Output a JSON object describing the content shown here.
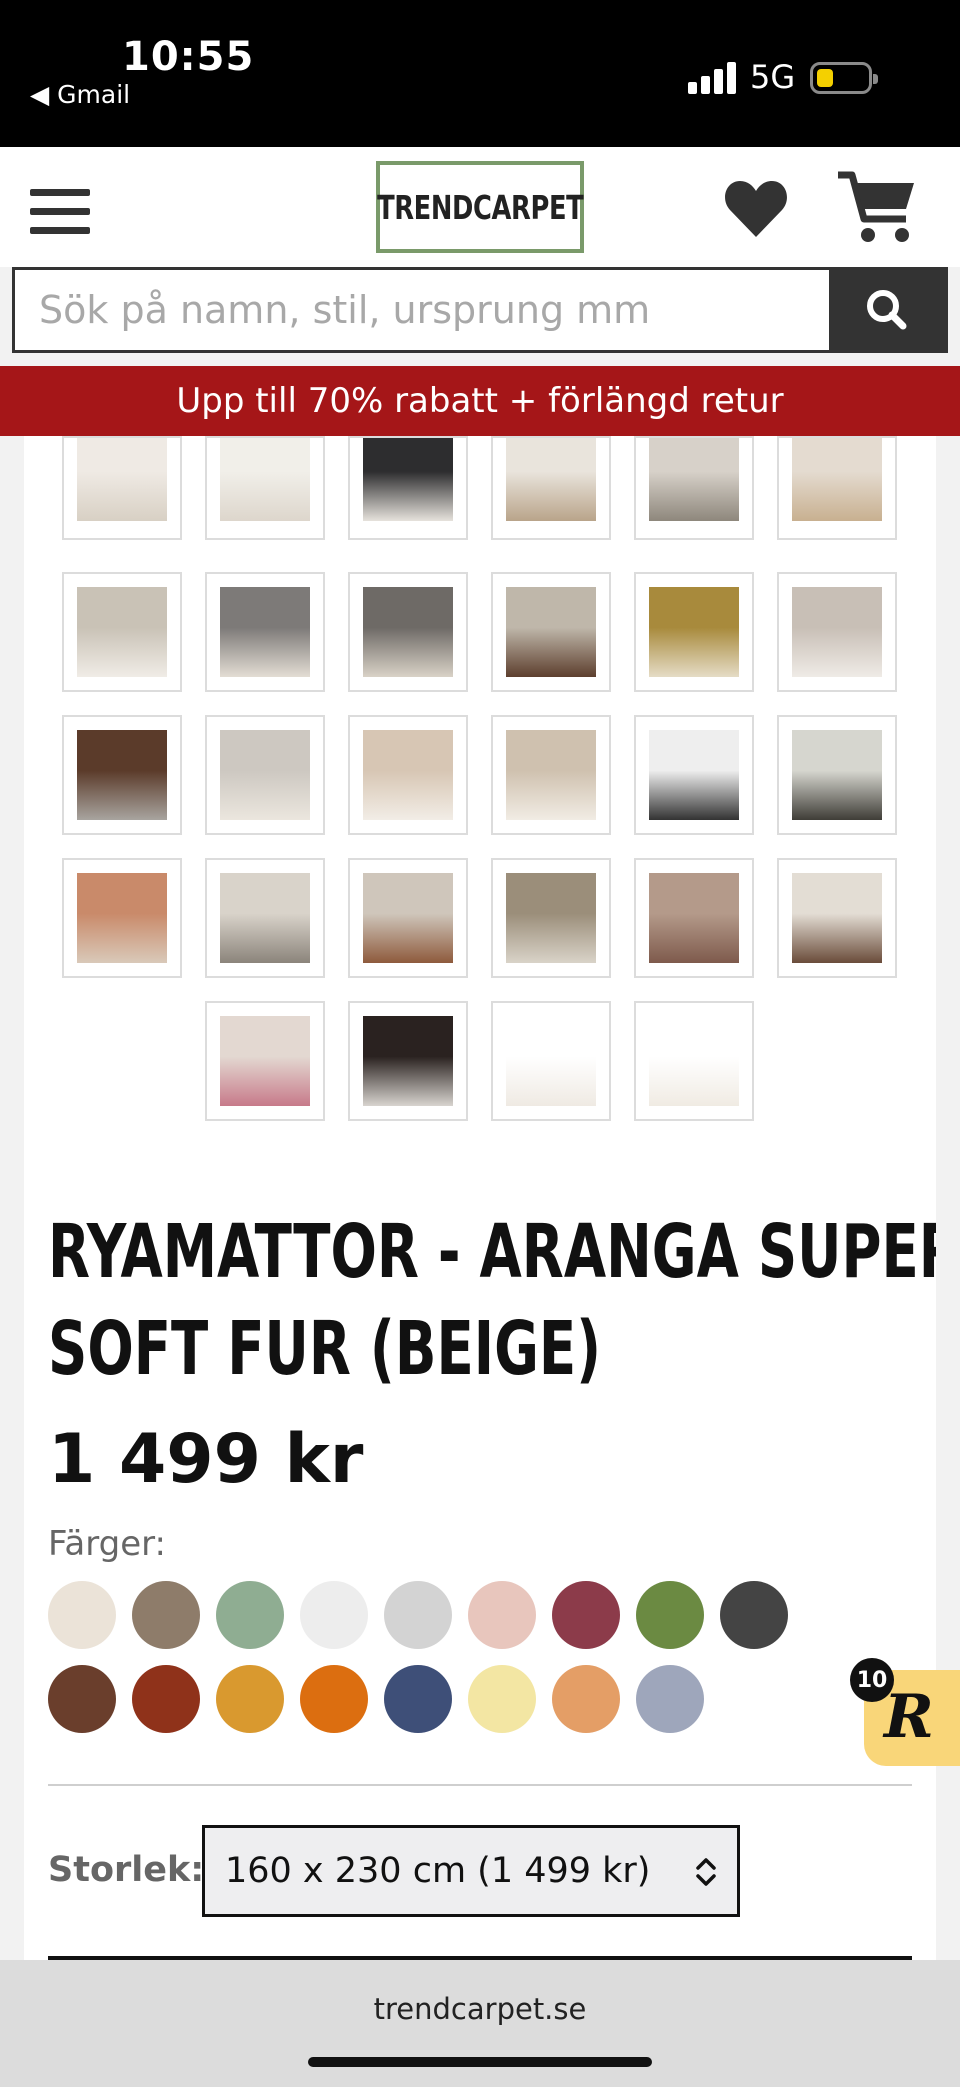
{
  "status_bar": {
    "time": "10:55",
    "back_app": "◀ Gmail",
    "network": "5G"
  },
  "header": {
    "logo_text": "TRENDCARPET",
    "menu_icon": "hamburger-icon",
    "wishlist_icon": "heart-icon",
    "cart_icon": "cart-icon"
  },
  "search": {
    "placeholder": "Sök på namn, stil, ursprung mm",
    "button_icon": "search-icon"
  },
  "promo": {
    "text": "Upp till 70% rabatt + förlängd retur"
  },
  "gallery": {
    "thumbnails": [
      {
        "colors": [
          "#efeae4",
          "#d8d0c4"
        ]
      },
      {
        "colors": [
          "#f1efe9",
          "#ddd6cc"
        ]
      },
      {
        "colors": [
          "#2d2d2f",
          "#e6e2dc"
        ]
      },
      {
        "colors": [
          "#e9e4dc",
          "#b9a48a"
        ]
      },
      {
        "colors": [
          "#d7d1c9",
          "#8e877c"
        ]
      },
      {
        "colors": [
          "#e4dbd0",
          "#c8b090"
        ]
      },
      {
        "colors": [
          "#c9c2b6",
          "#f0ece6"
        ]
      },
      {
        "colors": [
          "#7d7a78",
          "#e3ddd4"
        ]
      },
      {
        "colors": [
          "#6e6a66",
          "#d9d2c7"
        ]
      },
      {
        "colors": [
          "#bfb7aa",
          "#5d3f2e"
        ]
      },
      {
        "colors": [
          "#a88a3c",
          "#e5dcc6"
        ]
      },
      {
        "colors": [
          "#c8bfb6",
          "#efebe6"
        ]
      },
      {
        "colors": [
          "#5b3b2a",
          "#a8a49f"
        ]
      },
      {
        "colors": [
          "#cdc8c1",
          "#ebe6de"
        ]
      },
      {
        "colors": [
          "#d7c6b4",
          "#f2ede6"
        ]
      },
      {
        "colors": [
          "#cfc1af",
          "#f1ece4"
        ]
      },
      {
        "colors": [
          "#eeeeee",
          "#333333"
        ]
      },
      {
        "colors": [
          "#d6d6cf",
          "#3f3d37"
        ]
      },
      {
        "colors": [
          "#c98a6a",
          "#d9c9b9"
        ]
      },
      {
        "colors": [
          "#d9d3ca",
          "#8b847b"
        ]
      },
      {
        "colors": [
          "#cfc6bb",
          "#8e5a3c"
        ]
      },
      {
        "colors": [
          "#9b8e7a",
          "#d9d3c8"
        ]
      },
      {
        "colors": [
          "#b49a8a",
          "#7e5a4c"
        ]
      },
      {
        "colors": [
          "#e3ddd4",
          "#6a4c3a"
        ]
      },
      {
        "colors": [
          "#e3d8d1",
          "#c77a8a"
        ]
      },
      {
        "colors": [
          "#2a2220",
          "#d8d4cf"
        ]
      },
      {
        "colors": [
          "#ffffff",
          "#efeae3"
        ]
      },
      {
        "colors": [
          "#ffffff",
          "#f0ebe3"
        ]
      }
    ]
  },
  "product": {
    "title_line1": "RYAMATTOR - ARANGA SUPER",
    "title_line2": "SOFT FUR (BEIGE)",
    "price": "1 499 kr",
    "colors_label": "Färger:",
    "swatches": [
      "#ebe3d8",
      "#8e7c6a",
      "#8fad92",
      "#ededed",
      "#d3d3d3",
      "#e8c6bd",
      "#8c3b4a",
      "#6b8a42",
      "#444444",
      "#6a3e2c",
      "#8f321a",
      "#d9992f",
      "#dc6e10",
      "#3e4f78",
      "#f3e6a3",
      "#e49e66",
      "#9ea6bb"
    ],
    "size_label": "Storlek:",
    "size_selected": "160 x 230 cm (1 499 kr)"
  },
  "chat_widget": {
    "badge_count": "10",
    "letter": "R"
  },
  "browser": {
    "url": "trendcarpet.se"
  }
}
